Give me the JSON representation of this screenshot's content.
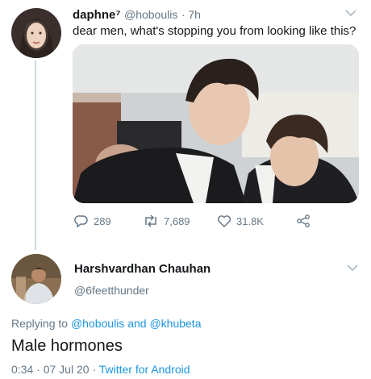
{
  "tweet1": {
    "display_name": "daphne⁷",
    "handle": "@hoboulis",
    "time": "· 7h",
    "text": "dear men, what's stopping you from looking like this?",
    "replies": "289",
    "retweets": "7,689",
    "likes": "31.8K"
  },
  "tweet2": {
    "display_name": "Harshvardhan Chauhan",
    "handle": "@6feetthunder",
    "replying_prefix": "Replying to",
    "reply_mention1": "@hoboulis",
    "reply_and": "and",
    "reply_mention2": "@khubeta",
    "text": "Male hormones",
    "timestamp": "0:34 · 07 Jul 20 ·",
    "client": "Twitter for Android"
  },
  "colors": {
    "accent": "#1b95e0",
    "muted": "#657786",
    "text": "#14171a"
  }
}
